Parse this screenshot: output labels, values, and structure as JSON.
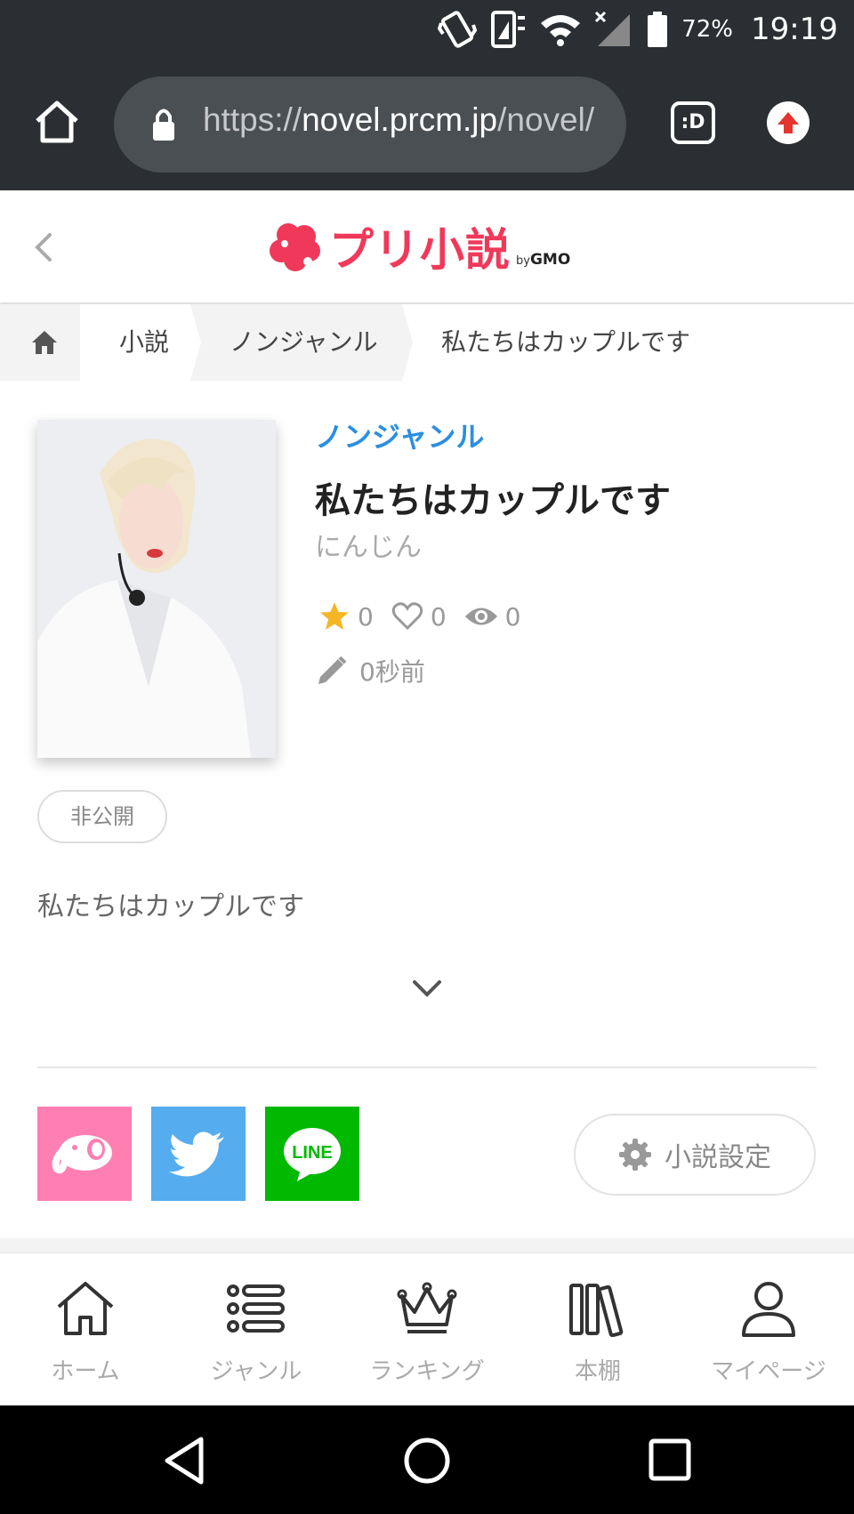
{
  "status_bar": {
    "battery": "72%",
    "time": "19:19"
  },
  "browser": {
    "url_prefix": "https://",
    "url_domain": "novel.prcm.jp",
    "url_path": "/novel/",
    "tabs_label": ":D"
  },
  "header": {
    "logo_text": "プリ小説",
    "logo_by": "by",
    "logo_company": "GMO"
  },
  "breadcrumb": {
    "items": [
      "小説",
      "ノンジャンル",
      "私たちはカップルです"
    ]
  },
  "novel": {
    "genre": "ノンジャンル",
    "title": "私たちはカップルです",
    "author": "にんじん",
    "stars": "0",
    "likes": "0",
    "views": "0",
    "updated": "0秒前",
    "status": "非公開",
    "summary": "私たちはカップルです",
    "settings_label": "小説設定"
  },
  "share": {
    "line_label": "LINE"
  },
  "bottom_nav": {
    "items": [
      "ホーム",
      "ジャンル",
      "ランキング",
      "本棚",
      "マイページ"
    ]
  },
  "colors": {
    "brand": "#f0395a",
    "genre_link": "#2b8fe0",
    "star": "#f5b623"
  }
}
